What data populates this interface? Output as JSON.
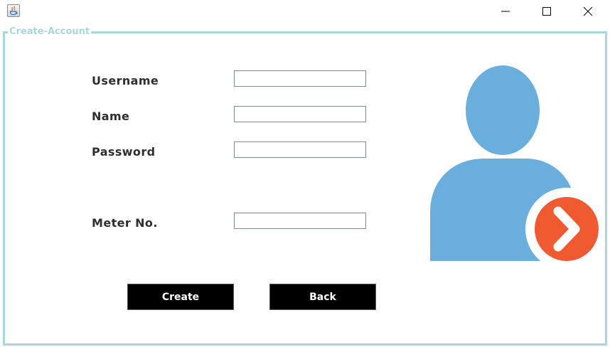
{
  "window": {
    "controls": {
      "minimize_icon": "minimize-icon",
      "maximize_icon": "maximize-icon",
      "close_icon": "close-icon"
    }
  },
  "panel": {
    "title": "Create-Account",
    "border_color": "#a8d8dc"
  },
  "form": {
    "username": {
      "label": "Username",
      "value": ""
    },
    "name": {
      "label": "Name",
      "value": ""
    },
    "password": {
      "label": "Password",
      "value": ""
    },
    "meter": {
      "label": "Meter No.",
      "value": ""
    }
  },
  "buttons": {
    "create": "Create",
    "back": "Back"
  },
  "illustration": {
    "icon": "user-add-icon",
    "person_color": "#6aaede",
    "badge_color": "#f05a30"
  }
}
